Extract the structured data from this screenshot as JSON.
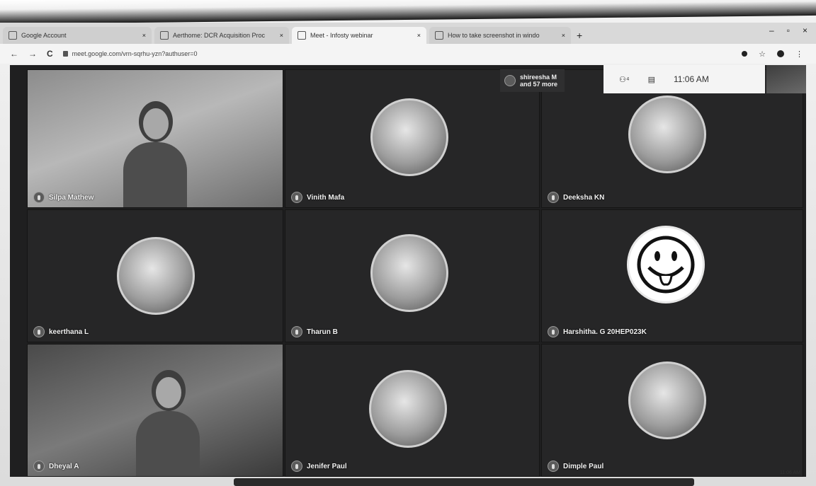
{
  "browser": {
    "tabs": [
      {
        "title": "Google Account"
      },
      {
        "title": "Aerthome: DCR Acquisition Proc"
      },
      {
        "title": "Meet - Infosty webinar"
      },
      {
        "title": "How to take screenshot in windo"
      }
    ],
    "new_tab": "+",
    "window_controls": [
      "–",
      "▫",
      "×"
    ],
    "nav": {
      "back": "←",
      "forward": "→",
      "reload": "C"
    },
    "url": "meet.google.com/vrn-sqrhu-yzn?authuser=0"
  },
  "meet": {
    "clock": "11:06 AM",
    "participants_badge": {
      "line1": "shireesha M",
      "line2": "and 57 more"
    },
    "participants": [
      {
        "name": "Silpa Mathew"
      },
      {
        "name": "Vinith Mafa"
      },
      {
        "name": "Deeksha KN"
      },
      {
        "name": "keerthana L"
      },
      {
        "name": "Tharun B"
      },
      {
        "name": "Harshitha. G 20HEP023K"
      },
      {
        "name": "Dheyal A"
      },
      {
        "name": "Jenifer Paul"
      },
      {
        "name": "Dimple Paul"
      }
    ]
  },
  "taskbar": {
    "time": "11:06 AM"
  },
  "icons": {
    "participants_icon": "people-icon",
    "chat_icon": "chat-icon",
    "smiley_avatar": "smiley-icon"
  }
}
